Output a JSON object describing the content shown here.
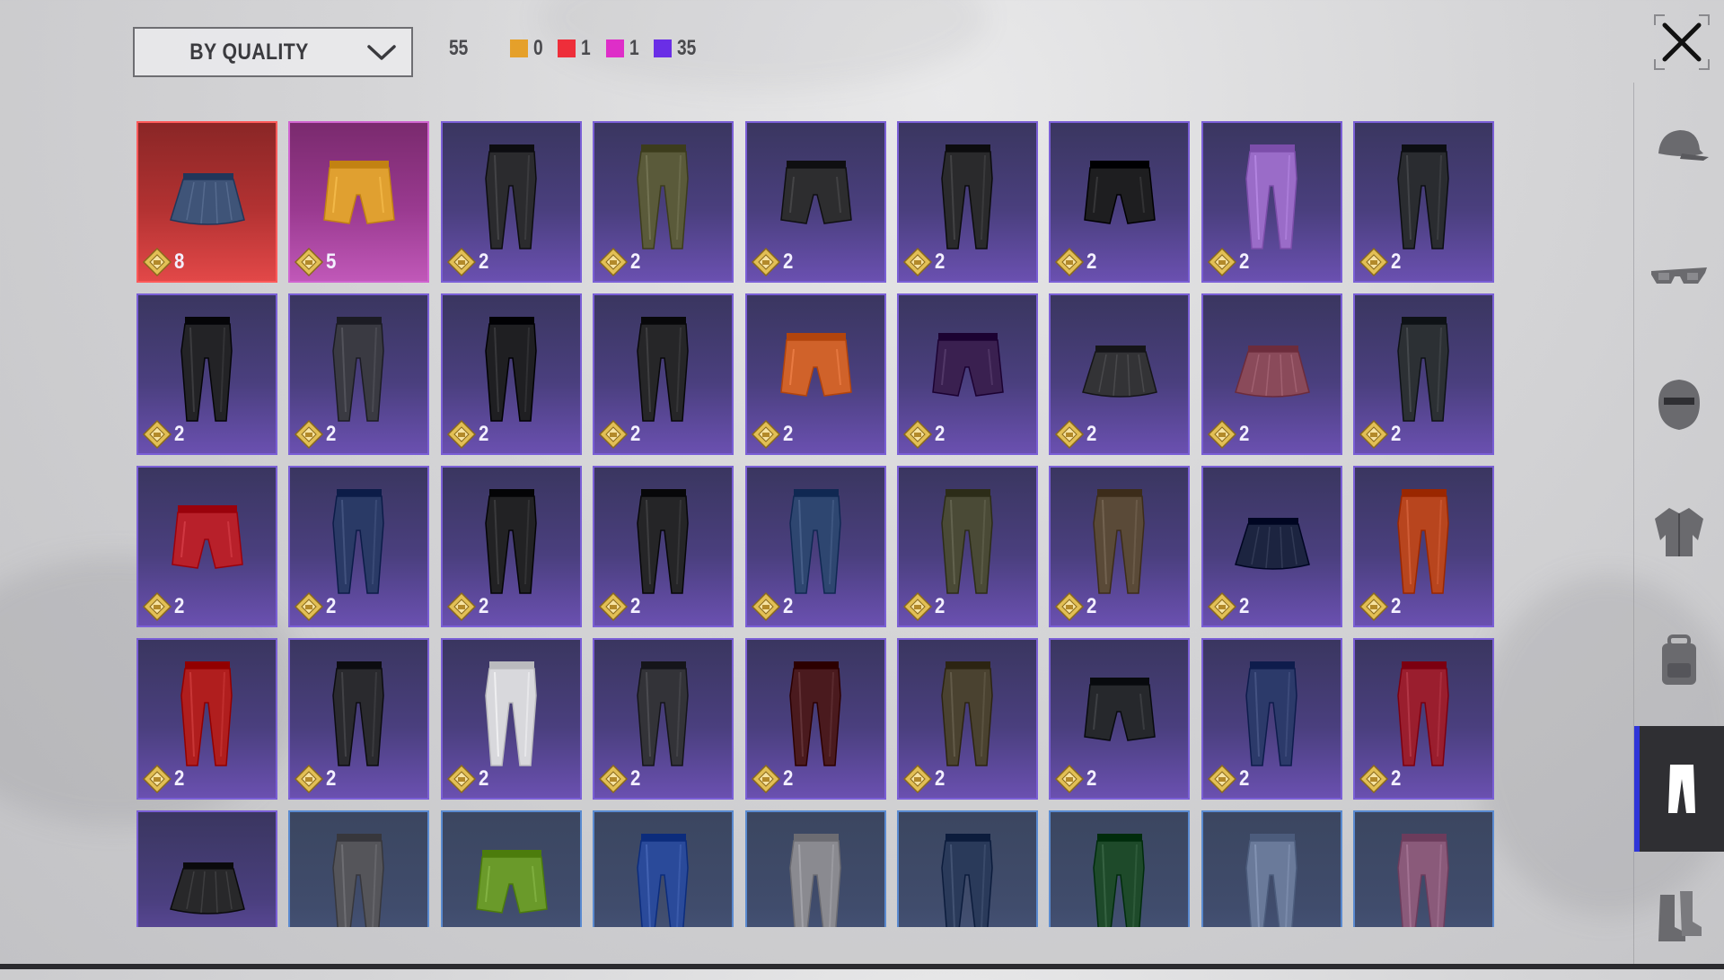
{
  "toolbar": {
    "sort_label": "BY QUALITY",
    "total_count": "55",
    "quality_counters": [
      {
        "color": "#e5a02a",
        "value": "0"
      },
      {
        "color": "#ee2e3a",
        "value": "1"
      },
      {
        "color": "#de2ec8",
        "value": "1"
      },
      {
        "color": "#6a2ee6",
        "value": "35"
      }
    ]
  },
  "sidebar": {
    "tabs": [
      {
        "name": "hat",
        "icon": "cap-icon"
      },
      {
        "name": "glasses",
        "icon": "glasses-icon"
      },
      {
        "name": "mask",
        "icon": "mask-icon"
      },
      {
        "name": "top",
        "icon": "jacket-icon"
      },
      {
        "name": "backpack",
        "icon": "backpack-icon"
      },
      {
        "name": "pants",
        "icon": "pants-icon",
        "active": true
      },
      {
        "name": "shoes",
        "icon": "boots-icon"
      }
    ]
  },
  "items": [
    {
      "quality": "red",
      "kind": "skirt",
      "color": "#3f5478",
      "count": "8"
    },
    {
      "quality": "pink",
      "kind": "shorts",
      "color": "#e0a030",
      "count": "5"
    },
    {
      "quality": "purple",
      "kind": "pants",
      "color": "#2b2b2e",
      "count": "2"
    },
    {
      "quality": "purple",
      "kind": "pants",
      "color": "#5a5a3a",
      "count": "2"
    },
    {
      "quality": "purple",
      "kind": "shorts",
      "color": "#2d2d2f",
      "count": "2"
    },
    {
      "quality": "purple",
      "kind": "pants",
      "color": "#2a2a2c",
      "count": "2"
    },
    {
      "quality": "purple",
      "kind": "shorts",
      "color": "#1e1e20",
      "count": "2"
    },
    {
      "quality": "purple",
      "kind": "pants",
      "color": "#9a6cc8",
      "count": "2"
    },
    {
      "quality": "purple",
      "kind": "pants",
      "color": "#2a2c30",
      "count": "2"
    },
    {
      "quality": "purple",
      "kind": "pants",
      "color": "#232326",
      "count": "2"
    },
    {
      "quality": "purple",
      "kind": "pants",
      "color": "#3a3a42",
      "count": "2"
    },
    {
      "quality": "purple",
      "kind": "pants",
      "color": "#1f1f22",
      "count": "2"
    },
    {
      "quality": "purple",
      "kind": "pants",
      "color": "#262628",
      "count": "2"
    },
    {
      "quality": "purple",
      "kind": "shorts",
      "color": "#d0622a",
      "count": "2"
    },
    {
      "quality": "purple",
      "kind": "shorts",
      "color": "#3a2050",
      "count": "2"
    },
    {
      "quality": "purple",
      "kind": "skirt",
      "color": "#333336",
      "count": "2"
    },
    {
      "quality": "purple",
      "kind": "skirt",
      "color": "#8a4a5a",
      "count": "2"
    },
    {
      "quality": "purple",
      "kind": "pants",
      "color": "#2c3034",
      "count": "2"
    },
    {
      "quality": "purple",
      "kind": "shorts",
      "color": "#b8202a",
      "count": "2"
    },
    {
      "quality": "purple",
      "kind": "pants",
      "color": "#2a3a66",
      "count": "2"
    },
    {
      "quality": "purple",
      "kind": "pants",
      "color": "#222224",
      "count": "2"
    },
    {
      "quality": "purple",
      "kind": "pants",
      "color": "#252527",
      "count": "2"
    },
    {
      "quality": "purple",
      "kind": "pants",
      "color": "#2e4670",
      "count": "2"
    },
    {
      "quality": "purple",
      "kind": "pants",
      "color": "#4a4a36",
      "count": "2"
    },
    {
      "quality": "purple",
      "kind": "pants",
      "color": "#5a4a38",
      "count": "2"
    },
    {
      "quality": "purple",
      "kind": "skirt",
      "color": "#1c2440",
      "count": "2"
    },
    {
      "quality": "purple",
      "kind": "pants",
      "color": "#b8451e",
      "count": "2"
    },
    {
      "quality": "purple",
      "kind": "pants",
      "color": "#b01e1e",
      "count": "2"
    },
    {
      "quality": "purple",
      "kind": "pants",
      "color": "#2a2a2e",
      "count": "2"
    },
    {
      "quality": "purple",
      "kind": "pants",
      "color": "#d8d8dc",
      "count": "2"
    },
    {
      "quality": "purple",
      "kind": "pants",
      "color": "#333338",
      "count": "2"
    },
    {
      "quality": "purple",
      "kind": "pants",
      "color": "#4a1a1e",
      "count": "2"
    },
    {
      "quality": "purple",
      "kind": "pants",
      "color": "#4a4230",
      "count": "2"
    },
    {
      "quality": "purple",
      "kind": "shorts",
      "color": "#26282c",
      "count": "2"
    },
    {
      "quality": "purple",
      "kind": "pants",
      "color": "#2c3a6a",
      "count": "2"
    },
    {
      "quality": "purple",
      "kind": "pants",
      "color": "#9a1e2e",
      "count": "2"
    },
    {
      "quality": "purple",
      "kind": "skirt",
      "color": "#28282a",
      "count": ""
    },
    {
      "quality": "blue",
      "kind": "pants",
      "color": "#55555a",
      "count": ""
    },
    {
      "quality": "blue",
      "kind": "shorts",
      "color": "#6a9a2a",
      "count": ""
    },
    {
      "quality": "blue",
      "kind": "pants",
      "color": "#2a4a9a",
      "count": ""
    },
    {
      "quality": "blue",
      "kind": "pants",
      "color": "#8a8a90",
      "count": ""
    },
    {
      "quality": "blue",
      "kind": "pants",
      "color": "#2a3a5a",
      "count": ""
    },
    {
      "quality": "blue",
      "kind": "pants",
      "color": "#1e4a2a",
      "count": ""
    },
    {
      "quality": "blue",
      "kind": "pants",
      "color": "#6a7a9a",
      "count": ""
    },
    {
      "quality": "blue",
      "kind": "pants",
      "color": "#8a5a7a",
      "count": ""
    }
  ]
}
